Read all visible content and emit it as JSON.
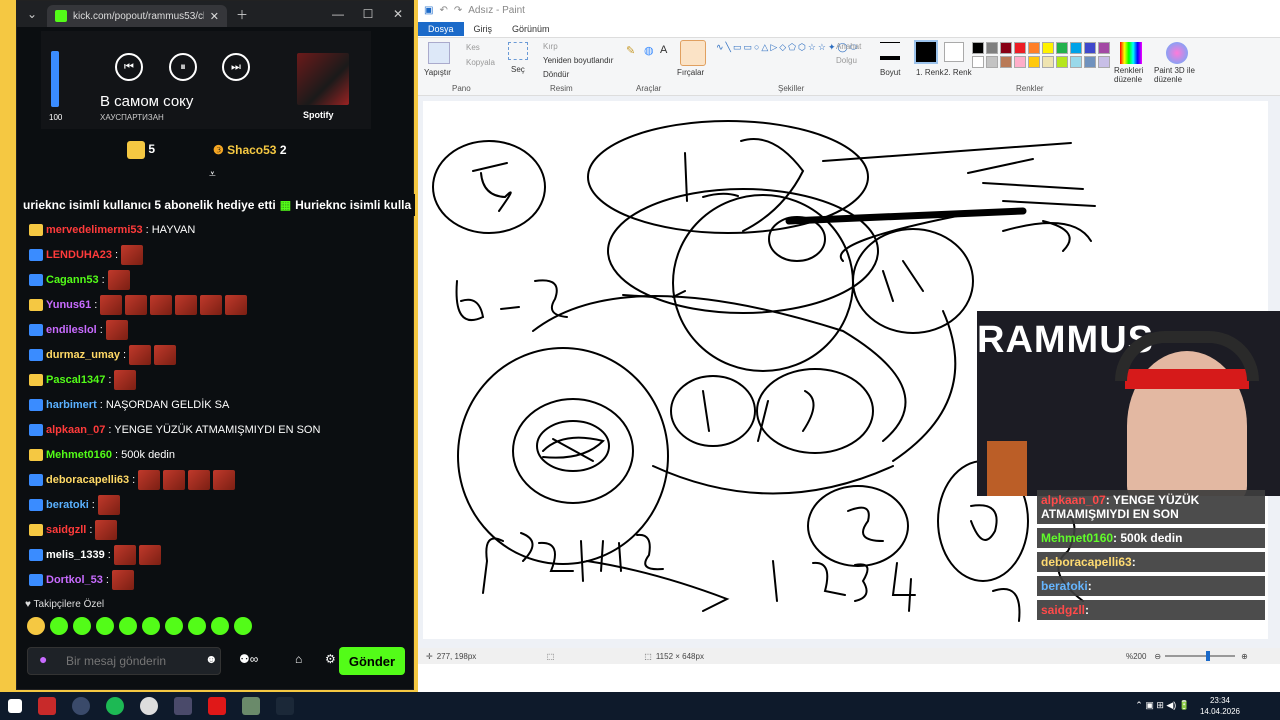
{
  "browser": {
    "tab_title": "kick.com/popout/rammus53/ch",
    "url": "kick.com/popout/rammus53/chat"
  },
  "spotify": {
    "volume": 100,
    "song": "В самом соку",
    "artist": "ХАУСПАРТИЗАН",
    "logo": "Spotify"
  },
  "gifters": [
    {
      "name": "Hurieknc",
      "count": "5"
    },
    {
      "name": "Shaco53",
      "count": "2"
    }
  ],
  "banner": {
    "text1": "urieknc isimli kullanıcı 5 abonelik hediye etti",
    "text2": "Hurieknc isimli kulla"
  },
  "messages": [
    {
      "user": "mervedelimermi53",
      "text": ": HAYVAN",
      "color": "#ff3b3b"
    },
    {
      "user": "LENDUHA23",
      "text": ":",
      "color": "#ff3b3b"
    },
    {
      "user": "Cagann53",
      "text": ":",
      "color": "#53fc18"
    },
    {
      "user": "Yunus61",
      "text": ":",
      "color": "#c86bff"
    },
    {
      "user": "endileslol",
      "text": ":",
      "color": "#c86bff"
    },
    {
      "user": "durmaz_umay",
      "text": ":",
      "color": "#ffd966"
    },
    {
      "user": "Pascal1347",
      "text": ":",
      "color": "#53fc18"
    },
    {
      "user": "harbimert",
      "text": ": NAŞORDAN GELDİK SA",
      "color": "#5ab0ff"
    },
    {
      "user": "alpkaan_07",
      "text": ": YENGE YÜZÜK ATMAMIŞMIYDI EN SON",
      "color": "#ff3b3b"
    },
    {
      "user": "Mehmet0160",
      "text": ": 500k dedin",
      "color": "#53fc18"
    },
    {
      "user": "deboracapelli63",
      "text": ":",
      "color": "#ffd966"
    },
    {
      "user": "beratoki",
      "text": ":",
      "color": "#5ab0ff"
    },
    {
      "user": "saidgzll",
      "text": ":",
      "color": "#ff3b3b"
    },
    {
      "user": "melis_1339",
      "text": ":",
      "color": "#ffffff"
    },
    {
      "user": "Dortkol_53",
      "text": ":",
      "color": "#c86bff"
    }
  ],
  "followers_label": "Takipçilere Özel",
  "chat_input": {
    "placeholder": "Bir mesaj gönderin",
    "send_label": "Gönder"
  },
  "paint": {
    "title": "Adsız - Paint",
    "tabs": [
      "Dosya",
      "Giriş",
      "Görünüm"
    ],
    "groups": [
      "Pano",
      "Resim",
      "Araçlar",
      "Şekiller",
      "Renkler"
    ],
    "tools": {
      "paste": "Yapıştır",
      "cut": "Kes",
      "copy": "Kopyala",
      "select": "Seç",
      "crop": "Kırp",
      "resize": "Yeniden boyutlandır",
      "rotate": "Döndür",
      "brushes": "Fırçalar",
      "outline": "Anahat",
      "fill": "Dolgu",
      "size": "Boyut",
      "color1": "1. Renk",
      "color2": "2. Renk",
      "edit_colors": "Renkleri düzenle",
      "paint3d": "Paint 3D ile düzenle"
    },
    "status": {
      "cursor": "277, 198px",
      "size": "1152 × 648px",
      "zoom": "%200"
    }
  },
  "cam_logo": "RAMMUS",
  "overlay_chat": [
    {
      "user": "alpkaan_07",
      "text": ": YENGE YÜZÜK ATMAMIŞMIYDI EN SON"
    },
    {
      "user": "Mehmet0160",
      "text": ": 500k dedin"
    },
    {
      "user": "deboracapelli63",
      "text": ":"
    },
    {
      "user": "beratoki",
      "text": ":"
    },
    {
      "user": "saidgzll",
      "text": ":"
    }
  ],
  "clock": {
    "time": "23:34",
    "date": "14.04.2026"
  }
}
